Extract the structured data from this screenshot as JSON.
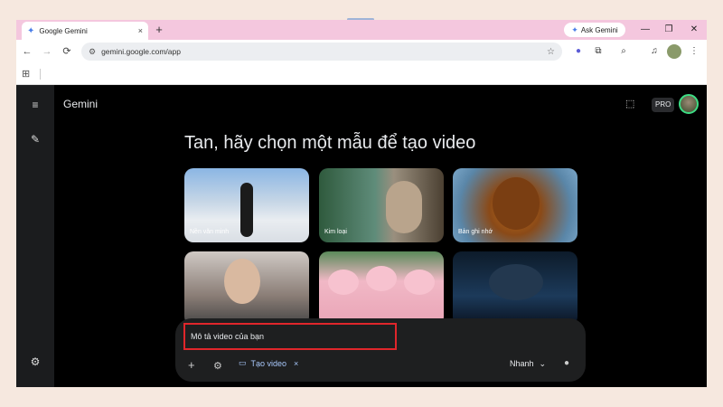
{
  "browser": {
    "tab_title": "Google Gemini",
    "tab_close": "×",
    "new_tab": "+",
    "ask_button": "Ask Gemini",
    "url": "gemini.google.com/app",
    "window_controls": {
      "minimize": "—",
      "restore": "❐",
      "close": "✕"
    },
    "nav": {
      "back": "←",
      "forward": "→",
      "reload": "⟳",
      "star": "☆",
      "menu": "⋮",
      "apps": "⊞"
    }
  },
  "app": {
    "title": "Gemini",
    "pro_badge": "PRO",
    "headline": "Tan, hãy chọn một mẫu để tạo video",
    "templates": [
      {
        "label": "Nền văn minh"
      },
      {
        "label": "Kim loại"
      },
      {
        "label": "Bản ghi nhớ"
      },
      {
        "label": ""
      },
      {
        "label": ""
      },
      {
        "label": ""
      }
    ],
    "prompt": {
      "placeholder": "Mô tả video của bạn",
      "add": "+",
      "tools": "⚙",
      "chip_label": "Tạo video",
      "chip_close": "×",
      "mode": "Nhanh",
      "mode_chevron": "⌄",
      "mic": "🎤"
    }
  },
  "colors": {
    "highlight_border": "#e0262b",
    "chip_accent": "#a8c7fa",
    "tab_strip": "#f4c7de"
  }
}
